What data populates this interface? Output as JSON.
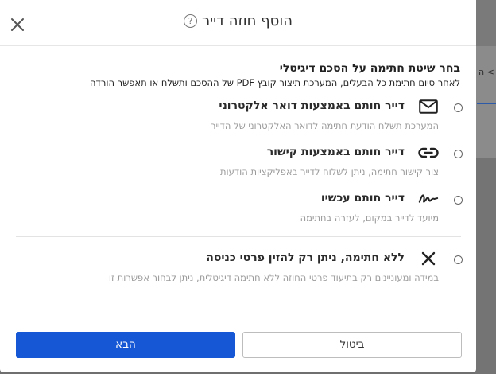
{
  "dialog": {
    "title": "הוסף חוזה דייר",
    "help_icon": "?",
    "section_title": "בחר שיטת חתימה על הסכם דיגיטלי",
    "section_subtitle": "לאחר סיום חתימת כל הבעלים, המערכת תיצור קובץ PDF של ההסכם ותשלח או תאפשר הורדה",
    "options": [
      {
        "icon": "envelope-icon",
        "label": "דייר חותם באמצעות דואר אלקטרוני",
        "description": "המערכת תשלח הודעת חתימה לדואר האלקטרוני של הדייר"
      },
      {
        "icon": "link-icon",
        "label": "דייר חותם באמצעות קישור",
        "description": "צור קישור חתימה, ניתן לשלוח לדייר באפליקציות הודעות"
      },
      {
        "icon": "signature-icon",
        "label": "דייר חותם עכשיו",
        "description": "מיועד לדייר במקום, לעזרה בחתימה"
      },
      {
        "icon": "x-icon",
        "label": "ללא חתימה, ניתן רק להזין פרטי כניסה",
        "description": "במידה ומעוניינים רק בתיעוד פרטי החוזה ללא חתימה דיגיטלית, ניתן לבחור אפשרות זו"
      }
    ],
    "next_label": "הבא",
    "cancel_label": "ביטול"
  },
  "background": {
    "tab_text": "ה <"
  },
  "colors": {
    "primary": "#1557d4",
    "muted_text": "#9a9a9a"
  }
}
